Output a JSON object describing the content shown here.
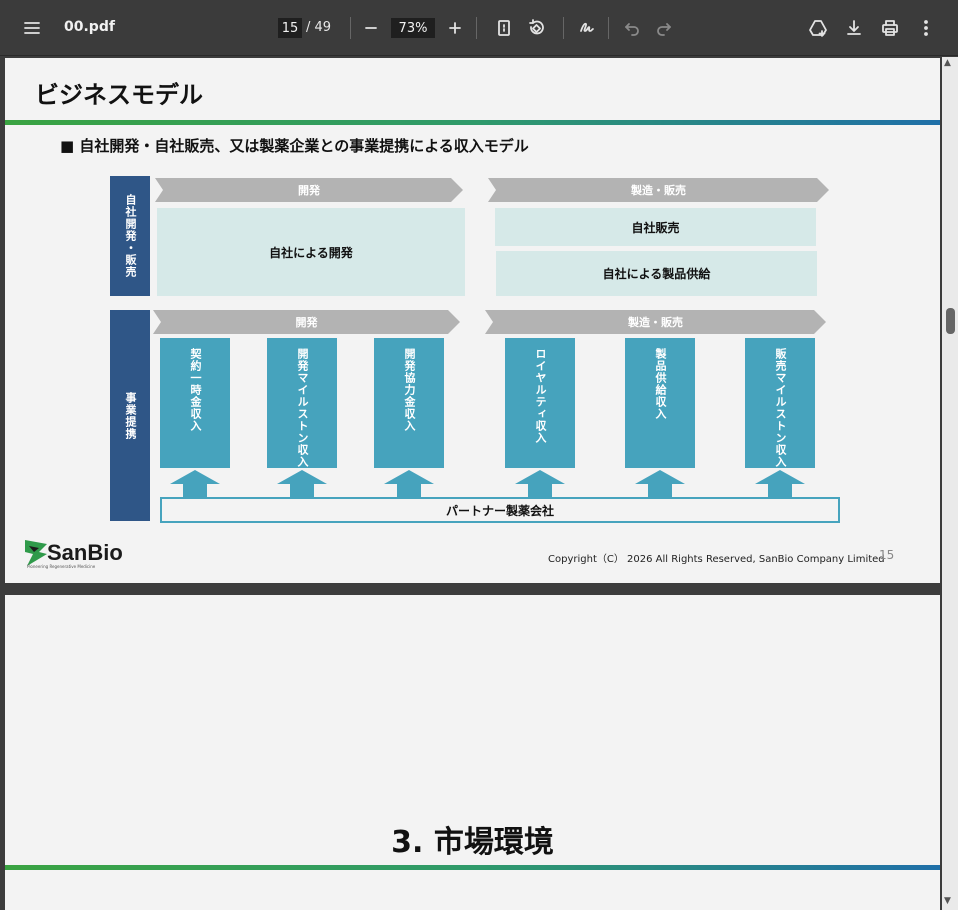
{
  "toolbar": {
    "filename": "00.pdf",
    "current_page": "15",
    "total_pages": "/ 49",
    "zoom": "73%"
  },
  "slide15": {
    "title": "ビジネスモデル",
    "subtitle": "■ 自社開発・自社販売、又は製薬企業との事業提携による収入モデル",
    "row1": {
      "label": "自社開発・販売",
      "chevron_dev": "開発",
      "chevron_sales": "製造・販売",
      "box_dev": "自社による開発",
      "box_sales": "自社販売",
      "box_supply": "自社による製品供給"
    },
    "row2": {
      "label": "事業提携",
      "chevron_dev": "開発",
      "chevron_sales": "製造・販売",
      "revenues": [
        "契約一時金収入",
        "開発マイルストン収入",
        "開発協力金収入",
        "ロイヤルティ収入",
        "製品供給収入",
        "販売マイルストン収入"
      ],
      "partner": "パートナー製薬会社"
    },
    "logo_text": "SanBio",
    "logo_tagline": "Pioneering Regenerative Medicine",
    "copyright": "Copyright（C） 2026 All Rights Reserved, SanBio Company Limited",
    "page_number": "15"
  },
  "slide16": {
    "title": "3. 市場環境"
  },
  "colors": {
    "navy": "#2f5687",
    "teal": "#46a3bd",
    "light_teal": "#d6e9e8",
    "gray_chevron": "#b3b3b3"
  }
}
